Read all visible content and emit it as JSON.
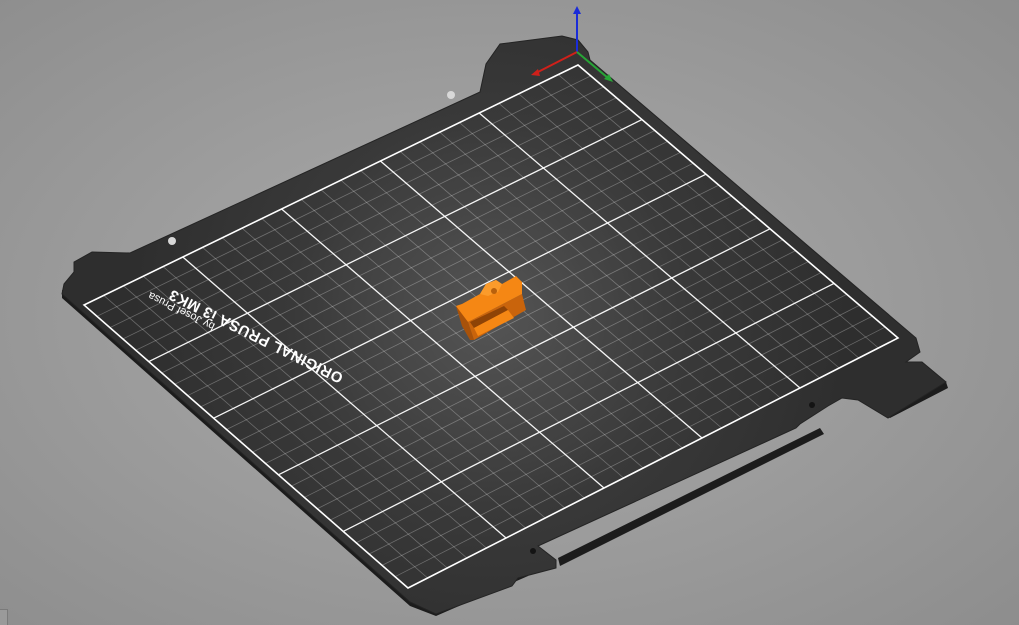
{
  "scene": {
    "background_center": "#a7a7a7",
    "background_edge": "#8a8a8a",
    "bed_color": "#2f2f2f",
    "bed_edge_color": "#1f1f1f",
    "grid_color": "#ffffff",
    "model_color": "#ec7c11"
  },
  "bed_label": {
    "title": "ORIGINAL PRUSA i3 MK3",
    "subtitle": "by Josef Prusa"
  },
  "axes": {
    "x_color": "#d0201a",
    "y_color": "#27a536",
    "z_color": "#1a2cd8"
  }
}
